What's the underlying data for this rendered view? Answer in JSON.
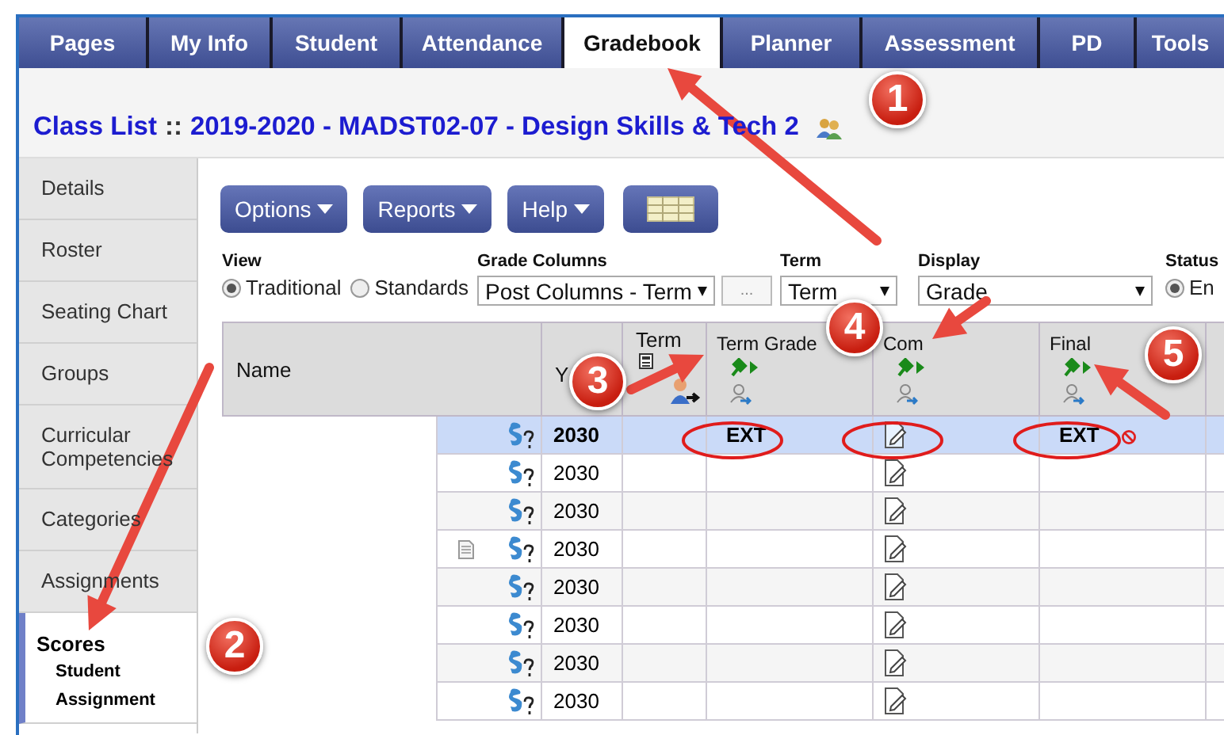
{
  "tabs": [
    {
      "label": "Pages",
      "selected": false
    },
    {
      "label": "My Info",
      "selected": false
    },
    {
      "label": "Student",
      "selected": false
    },
    {
      "label": "Attendance",
      "selected": false
    },
    {
      "label": "Gradebook",
      "selected": true
    },
    {
      "label": "Planner",
      "selected": false
    },
    {
      "label": "Assessment",
      "selected": false
    },
    {
      "label": "PD",
      "selected": false
    },
    {
      "label": "Tools",
      "selected": false
    }
  ],
  "title": {
    "label": "Class List",
    "separator": "::",
    "course": "2019-2020 - MADST02-07 - Design Skills & Tech 2"
  },
  "sidebar": {
    "items": [
      {
        "label": "Details",
        "selected": false
      },
      {
        "label": "Roster",
        "selected": false
      },
      {
        "label": "Seating Chart",
        "selected": false
      },
      {
        "label": "Groups",
        "selected": false
      },
      {
        "label": "Curricular Competencies",
        "selected": false
      },
      {
        "label": "Categories",
        "selected": false
      },
      {
        "label": "Assignments",
        "selected": false
      },
      {
        "label": "Scores",
        "selected": true,
        "children": [
          {
            "label": "Student"
          },
          {
            "label": "Assignment"
          }
        ]
      }
    ]
  },
  "toolbar": {
    "buttons": [
      {
        "kind": "menu",
        "label": "Options"
      },
      {
        "kind": "menu",
        "label": "Reports"
      },
      {
        "kind": "menu",
        "label": "Help"
      },
      {
        "kind": "grid"
      }
    ]
  },
  "filters": {
    "view": {
      "label": "View",
      "options": [
        {
          "label": "Traditional",
          "selected": true
        },
        {
          "label": "Standards",
          "selected": false
        }
      ]
    },
    "grade_columns": {
      "label": "Grade Columns",
      "value": "Post Columns - Term",
      "more_button": "..."
    },
    "term": {
      "label": "Term",
      "value": "Term"
    },
    "display": {
      "label": "Display",
      "value": "Grade"
    },
    "status": {
      "label": "Status",
      "options": [
        {
          "label": "En",
          "selected": true
        }
      ]
    }
  },
  "table": {
    "columns": [
      {
        "kind": "name",
        "label": "Name"
      },
      {
        "kind": "year",
        "label": "Y"
      },
      {
        "kind": "term",
        "label": "Term"
      },
      {
        "kind": "grade",
        "label": "Term Grade"
      },
      {
        "kind": "comment",
        "label": "Com"
      },
      {
        "kind": "grade",
        "label": "Final"
      },
      {
        "kind": "blank"
      }
    ],
    "rows": [
      {
        "year": "2030",
        "selected": true,
        "note": false,
        "term_grade": "EXT",
        "final": "EXT"
      },
      {
        "year": "2030",
        "selected": false,
        "note": false
      },
      {
        "year": "2030",
        "selected": false,
        "note": false
      },
      {
        "year": "2030",
        "selected": false,
        "note": true
      },
      {
        "year": "2030",
        "selected": false,
        "note": false
      },
      {
        "year": "2030",
        "selected": false,
        "note": false
      },
      {
        "year": "2030",
        "selected": false,
        "note": false
      },
      {
        "year": "2030",
        "selected": false,
        "note": false
      }
    ]
  },
  "callouts": [
    {
      "number": "1"
    },
    {
      "number": "2"
    },
    {
      "number": "3"
    },
    {
      "number": "4"
    },
    {
      "number": "5"
    }
  ]
}
